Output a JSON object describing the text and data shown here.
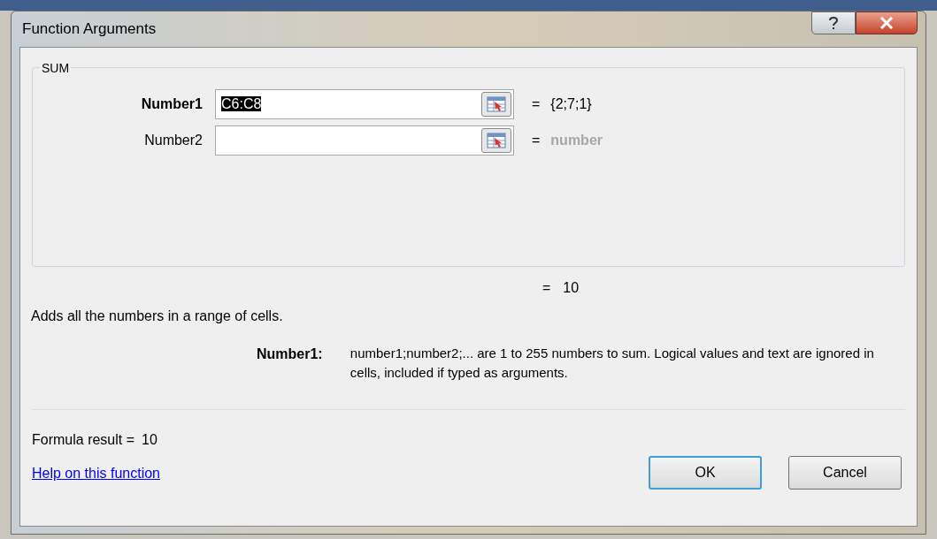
{
  "window": {
    "title": "Function Arguments"
  },
  "function_group": {
    "title": "SUM",
    "arguments": [
      {
        "label": "Number1",
        "active": true,
        "value": "C6:C8",
        "equals": "=",
        "result": "{2;7;1}",
        "result_is_hint": false
      },
      {
        "label": "Number2",
        "active": false,
        "equals": "=",
        "result": "number",
        "result_is_hint": true
      }
    ]
  },
  "result": {
    "equals": "=",
    "value": "10"
  },
  "description": "Adds all the numbers in a range of cells.",
  "argument_help": {
    "label": "Number1:",
    "text": "number1;number2;... are 1 to 255 numbers to sum. Logical values and text are ignored in cells, included if typed as arguments."
  },
  "formula_result": {
    "label": "Formula result =",
    "value": "10"
  },
  "help_link": "Help on this function",
  "buttons": [
    {
      "label": "OK",
      "default": true
    },
    {
      "label": "Cancel",
      "default": false
    }
  ]
}
